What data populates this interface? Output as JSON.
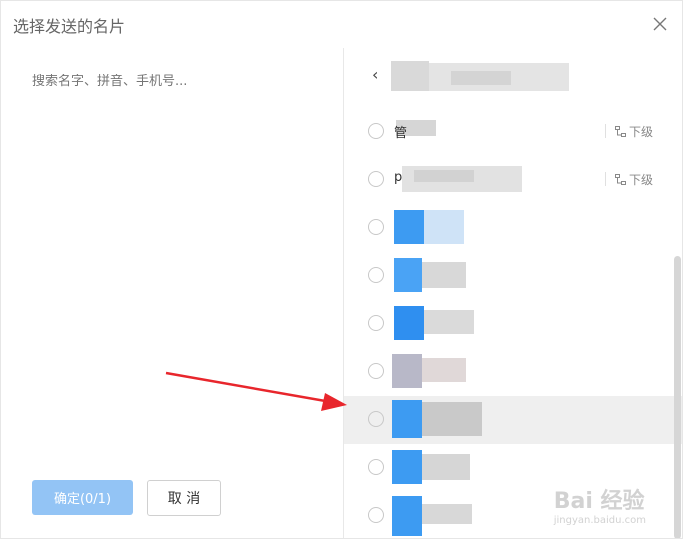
{
  "dialog": {
    "title": "选择发送的名片",
    "close_icon": "close-icon"
  },
  "search": {
    "placeholder": "搜索名字、拼音、手机号..."
  },
  "buttons": {
    "confirm_label": "确定(0/1)",
    "cancel_label": "取 消"
  },
  "breadcrumb": {
    "back_symbol": "‹"
  },
  "list": {
    "subdept_label": "下级",
    "rows": [
      {
        "prefix": "管",
        "has_subdept": true
      },
      {
        "prefix": "p",
        "has_subdept": true
      },
      {
        "prefix": "",
        "has_subdept": false
      },
      {
        "prefix": "",
        "has_subdept": false
      },
      {
        "prefix": "",
        "has_subdept": false
      },
      {
        "prefix": "",
        "has_subdept": false
      },
      {
        "prefix": "",
        "has_subdept": false,
        "hovered": true
      },
      {
        "prefix": "",
        "has_subdept": false
      },
      {
        "prefix": "",
        "has_subdept": false
      }
    ]
  },
  "watermark": {
    "text": "Bai 经验",
    "url": "jingyan.baidu.com"
  },
  "colors": {
    "confirm_disabled": "#93c4f5",
    "annotation_arrow": "#e8262c",
    "hover_row": "#efefef"
  }
}
